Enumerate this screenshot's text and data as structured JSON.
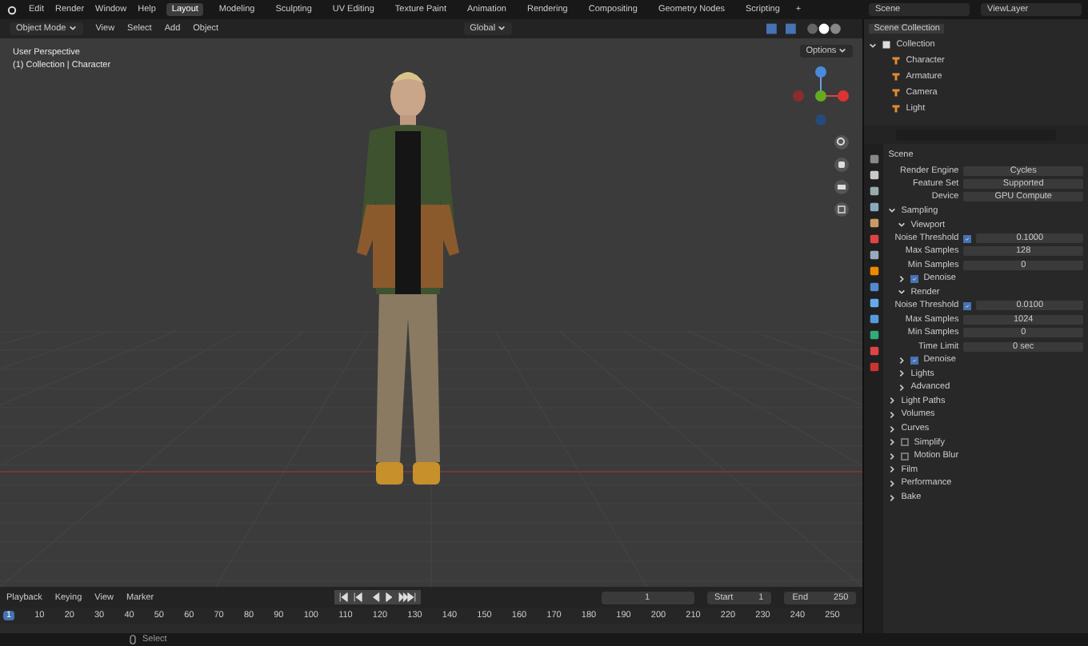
{
  "menu": [
    "Edit",
    "Render",
    "Window",
    "Help"
  ],
  "workspaces": [
    {
      "label": "Layout",
      "selected": true
    },
    {
      "label": "Modeling",
      "selected": false
    },
    {
      "label": "Sculpting",
      "selected": false
    },
    {
      "label": "UV Editing",
      "selected": false
    },
    {
      "label": "Texture Paint",
      "selected": false
    },
    {
      "label": "Animation",
      "selected": false
    },
    {
      "label": "Rendering",
      "selected": false
    },
    {
      "label": "Compositing",
      "selected": false
    },
    {
      "label": "Geometry Nodes",
      "selected": false
    },
    {
      "label": "Scripting",
      "selected": false
    }
  ],
  "add_workspace": "+",
  "scene": "Scene",
  "view_layer": "ViewLayer",
  "viewport_header": {
    "mode": "Object Mode",
    "menus": [
      "View",
      "Select",
      "Add",
      "Object"
    ],
    "orientation": "Global"
  },
  "viewport": {
    "perspective": "User Perspective",
    "context": "(1) Collection | Character",
    "options": "Options"
  },
  "outliner": {
    "root": "Scene Collection",
    "collection": {
      "label": "Collection",
      "expanded": true,
      "children": [
        {
          "label": "Character"
        },
        {
          "label": "Armature"
        },
        {
          "label": "Camera"
        },
        {
          "label": "Light"
        }
      ]
    }
  },
  "properties": {
    "title": "Scene",
    "fields": [
      {
        "label": "Render Engine",
        "value": "Cycles"
      },
      {
        "label": "Feature Set",
        "value": "Supported"
      },
      {
        "label": "Device",
        "value": "GPU Compute"
      }
    ],
    "panels": [
      {
        "label": "Sampling",
        "expanded": true,
        "children": [
          {
            "kind": "subpanel",
            "label": "Viewport",
            "expanded": true,
            "children": [
              {
                "kind": "threshold",
                "label": "Noise Threshold",
                "checked": true,
                "value": "0.1000"
              },
              {
                "kind": "field",
                "label": "Max Samples",
                "value": "128"
              },
              {
                "kind": "field",
                "label": "Min Samples",
                "value": "0"
              }
            ]
          },
          {
            "kind": "checkpanel",
            "label": "Denoise",
            "checked": true,
            "expanded": false
          },
          {
            "kind": "subpanel",
            "label": "Render",
            "expanded": true,
            "children": [
              {
                "kind": "threshold",
                "label": "Noise Threshold",
                "checked": true,
                "value": "0.0100"
              },
              {
                "kind": "field",
                "label": "Max Samples",
                "value": "1024"
              },
              {
                "kind": "field",
                "label": "Min Samples",
                "value": "0"
              },
              {
                "kind": "field",
                "label": "Time Limit",
                "value": "0 sec"
              }
            ]
          },
          {
            "kind": "checkpanel",
            "label": "Denoise",
            "checked": true,
            "expanded": false
          },
          {
            "kind": "subpanel",
            "label": "Lights",
            "expanded": false
          },
          {
            "kind": "subpanel",
            "label": "Advanced",
            "expanded": false
          }
        ]
      },
      {
        "label": "Light Paths",
        "expanded": false
      },
      {
        "label": "Volumes",
        "expanded": false
      },
      {
        "label": "Curves",
        "expanded": false
      },
      {
        "label": "Simplify",
        "expanded": false,
        "checked": false
      },
      {
        "label": "Motion Blur",
        "expanded": false,
        "checked": false
      },
      {
        "label": "Film",
        "expanded": false
      },
      {
        "label": "Performance",
        "expanded": false
      },
      {
        "label": "Bake",
        "expanded": false
      }
    ]
  },
  "timeline": {
    "menus": [
      "Playback",
      "Keying",
      "View",
      "Marker"
    ],
    "current_frame": "1",
    "start_label": "Start",
    "start": "1",
    "end_label": "End",
    "end": "250",
    "ticks": [
      "1",
      "10",
      "20",
      "30",
      "40",
      "50",
      "60",
      "70",
      "80",
      "90",
      "100",
      "110",
      "120",
      "130",
      "140",
      "150",
      "160",
      "170",
      "180",
      "190",
      "200",
      "210",
      "220",
      "230",
      "240",
      "250"
    ]
  },
  "status_bar": {
    "select": "Select"
  }
}
